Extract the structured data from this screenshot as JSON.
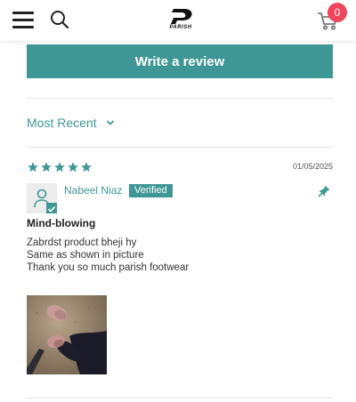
{
  "header": {
    "logo_text": "PARISH",
    "cart_count": "0",
    "icons": [
      "menu-icon",
      "search-icon",
      "parish-logo",
      "cart-icon"
    ],
    "badge_color": "#f0465b"
  },
  "reviews": {
    "write_review_label": "Write a review",
    "sort_label": "Most Recent",
    "accent_color": "#3f9795",
    "items": [
      {
        "rating": 5,
        "date": "01/05/2025",
        "author": "Nabeel Niaz",
        "verified_label": "Verified",
        "title": "Mind-blowing",
        "body_lines": [
          "Zabrdst product bheji hy",
          "Same as shown in picture",
          "Thank you so much parish footwear"
        ]
      }
    ]
  }
}
